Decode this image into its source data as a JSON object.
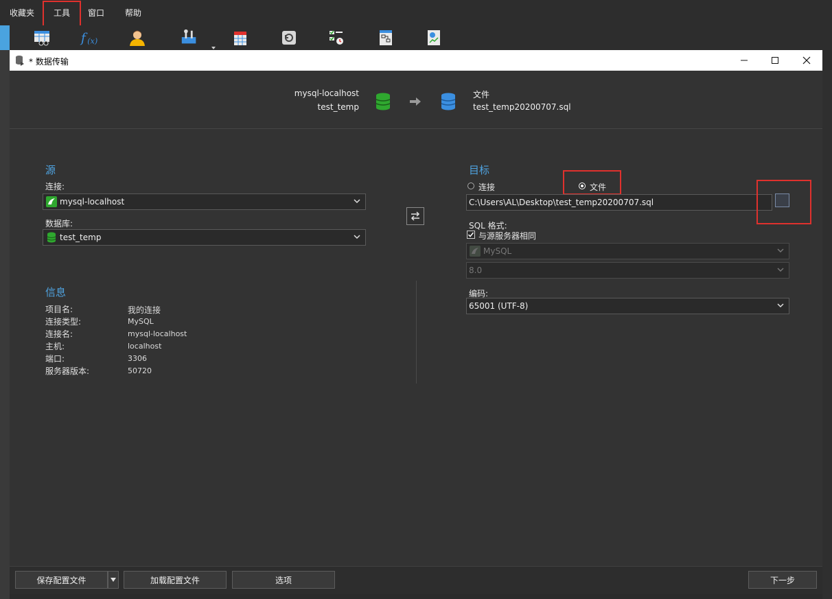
{
  "menubar": {
    "items": [
      "收藏夹",
      "工具",
      "窗口",
      "帮助"
    ]
  },
  "toolbar": {
    "icons": [
      "table-icon",
      "function-icon",
      "user-icon",
      "tools-icon",
      "query-grid-icon",
      "restore-icon",
      "schedule-icon",
      "model-icon",
      "chart-icon"
    ]
  },
  "dialog": {
    "title": "* 数据传输",
    "header": {
      "source_connection": "mysql-localhost",
      "source_database": "test_temp",
      "target_label": "文件",
      "target_file": "test_temp20200707.sql"
    },
    "source": {
      "section_title": "源",
      "connection_label": "连接:",
      "connection_value": "mysql-localhost",
      "database_label": "数据库:",
      "database_value": "test_temp"
    },
    "target": {
      "section_title": "目标",
      "radio_connection": "连接",
      "radio_file": "文件",
      "selected": "file",
      "file_path": "C:\\Users\\AL\\Desktop\\test_temp20200707.sql",
      "sql_format_label": "SQL 格式:",
      "same_as_source_label": "与源服务器相同",
      "same_as_source_checked": true,
      "server_type": "MySQL",
      "server_version": "8.0",
      "encoding_label": "编码:",
      "encoding_value": "65001 (UTF-8)"
    },
    "info": {
      "section_title": "信息",
      "rows": [
        {
          "key": "项目名:",
          "value": "我的连接"
        },
        {
          "key": "连接类型:",
          "value": "MySQL"
        },
        {
          "key": "连接名:",
          "value": "mysql-localhost"
        },
        {
          "key": "主机:",
          "value": "localhost"
        },
        {
          "key": "端口:",
          "value": "3306"
        },
        {
          "key": "服务器版本:",
          "value": "50720"
        }
      ]
    },
    "footer": {
      "save_profile": "保存配置文件",
      "load_profile": "加载配置文件",
      "options": "选项",
      "next": "下一步"
    }
  },
  "colors": {
    "accent": "#4fa3e0",
    "highlight": "#e0312d",
    "db_green": "#2fa82f",
    "db_blue": "#3b8fe0"
  }
}
